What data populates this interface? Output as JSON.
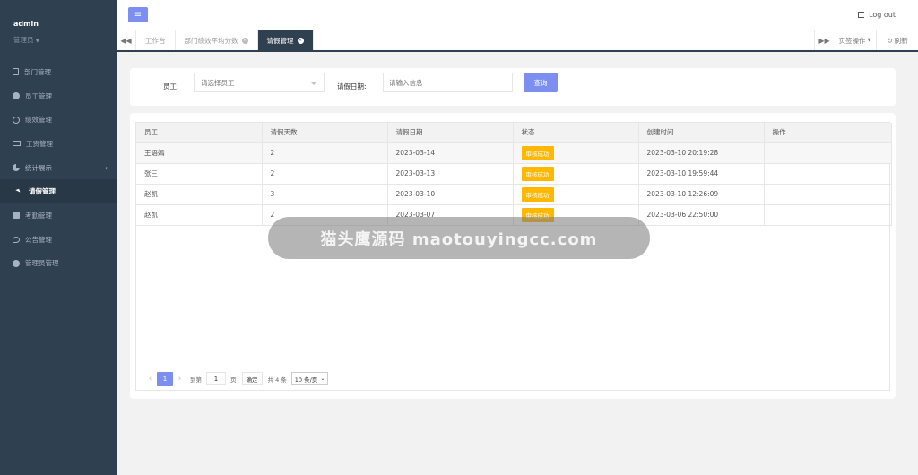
{
  "user": {
    "name": "admin",
    "role": "管理员"
  },
  "sidebar": {
    "items": [
      {
        "label": "部门管理",
        "icon": "book-icon"
      },
      {
        "label": "员工管理",
        "icon": "user-icon"
      },
      {
        "label": "绩效管理",
        "icon": "gauge-icon"
      },
      {
        "label": "工资管理",
        "icon": "money-icon"
      },
      {
        "label": "统计展示",
        "icon": "pie-chart-icon"
      },
      {
        "label": "请假管理",
        "icon": "paper-plane-icon",
        "active": true
      },
      {
        "label": "考勤管理",
        "icon": "edit-icon"
      },
      {
        "label": "公告管理",
        "icon": "chat-icon"
      },
      {
        "label": "管理员管理",
        "icon": "user-circle-icon"
      }
    ]
  },
  "header": {
    "logout_label": "Log out"
  },
  "tabs": {
    "items": [
      {
        "label": "工作台"
      },
      {
        "label": "部门绩效平均分数"
      },
      {
        "label": "请假管理",
        "active": true
      }
    ],
    "ops_label": "页签操作",
    "refresh_label": "刷新"
  },
  "search": {
    "employee_label": "员工:",
    "employee_placeholder": "请选择员工",
    "date_label": "请假日期:",
    "date_placeholder": "请输入信息",
    "query_label": "查询"
  },
  "table": {
    "columns": [
      "员工",
      "请假天数",
      "请假日期",
      "状态",
      "创建时间",
      "操作"
    ],
    "rows": [
      {
        "employee": "王语嫣",
        "days": "2",
        "date": "2023-03-14",
        "status": "审核成功",
        "created": "2023-03-10 20:19:28"
      },
      {
        "employee": "张三",
        "days": "2",
        "date": "2023-03-13",
        "status": "审核成功",
        "created": "2023-03-10 19:59:44"
      },
      {
        "employee": "赵凯",
        "days": "3",
        "date": "2023-03-10",
        "status": "审核成功",
        "created": "2023-03-10 12:26:09"
      },
      {
        "employee": "赵凯",
        "days": "2",
        "date": "2023-03-07",
        "status": "审核成功",
        "created": "2023-03-06 22:50:00"
      }
    ]
  },
  "pager": {
    "current": "1",
    "goto_label": "到第",
    "page_input": "1",
    "page_unit": "页",
    "confirm_label": "确定",
    "total_label": "共 4 条",
    "size_label": "10 条/页"
  },
  "watermark": {
    "text": "猫头鹰源码 maotouyingcc.com"
  },
  "colors": {
    "sidebar": "#2f4050",
    "accent": "#7c8ef0",
    "badge": "#ffb800"
  }
}
